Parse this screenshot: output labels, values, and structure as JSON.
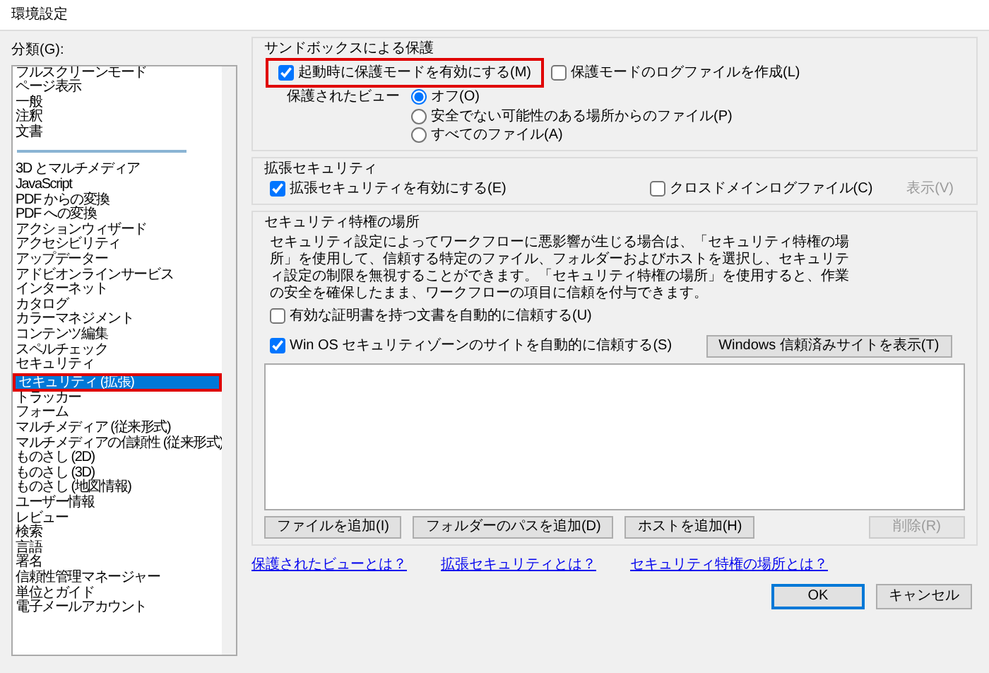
{
  "window": {
    "title": "環境設定"
  },
  "categories": {
    "label": "分類(G):",
    "groups": [
      [
        {
          "label": "フルスクリーンモード",
          "selected": false,
          "highlighted": false
        },
        {
          "label": "ページ表示",
          "selected": false,
          "highlighted": false
        },
        {
          "label": "一般",
          "selected": false,
          "highlighted": false
        },
        {
          "label": "注釈",
          "selected": false,
          "highlighted": false
        },
        {
          "label": "文書",
          "selected": false,
          "highlighted": false
        }
      ],
      [
        {
          "label": "3D とマルチメディア",
          "selected": false,
          "highlighted": false
        },
        {
          "label": "JavaScript",
          "selected": false,
          "highlighted": false
        },
        {
          "label": "PDF からの変換",
          "selected": false,
          "highlighted": false
        },
        {
          "label": "PDF への変換",
          "selected": false,
          "highlighted": false
        },
        {
          "label": "アクションウィザード",
          "selected": false,
          "highlighted": false
        },
        {
          "label": "アクセシビリティ",
          "selected": false,
          "highlighted": false
        },
        {
          "label": "アップデーター",
          "selected": false,
          "highlighted": false
        },
        {
          "label": "アドビオンラインサービス",
          "selected": false,
          "highlighted": false
        },
        {
          "label": "インターネット",
          "selected": false,
          "highlighted": false
        },
        {
          "label": "カタログ",
          "selected": false,
          "highlighted": false
        },
        {
          "label": "カラーマネジメント",
          "selected": false,
          "highlighted": false
        },
        {
          "label": "コンテンツ編集",
          "selected": false,
          "highlighted": false
        },
        {
          "label": "スペルチェック",
          "selected": false,
          "highlighted": false
        },
        {
          "label": "セキュリティ",
          "selected": false,
          "highlighted": false
        },
        {
          "label": "セキュリティ (拡張)",
          "selected": true,
          "highlighted": true
        },
        {
          "label": "トラッカー",
          "selected": false,
          "highlighted": false
        },
        {
          "label": "フォーム",
          "selected": false,
          "highlighted": false
        },
        {
          "label": "マルチメディア (従来形式)",
          "selected": false,
          "highlighted": false
        },
        {
          "label": "マルチメディアの信頼性 (従来形式)",
          "selected": false,
          "highlighted": false
        },
        {
          "label": "ものさし (2D)",
          "selected": false,
          "highlighted": false
        },
        {
          "label": "ものさし (3D)",
          "selected": false,
          "highlighted": false
        },
        {
          "label": "ものさし (地図情報)",
          "selected": false,
          "highlighted": false
        },
        {
          "label": "ユーザー情報",
          "selected": false,
          "highlighted": false
        },
        {
          "label": "レビュー",
          "selected": false,
          "highlighted": false
        },
        {
          "label": "検索",
          "selected": false,
          "highlighted": false
        },
        {
          "label": "言語",
          "selected": false,
          "highlighted": false
        },
        {
          "label": "署名",
          "selected": false,
          "highlighted": false
        },
        {
          "label": "信頼性管理マネージャー",
          "selected": false,
          "highlighted": false
        },
        {
          "label": "単位とガイド",
          "selected": false,
          "highlighted": false
        },
        {
          "label": "電子メールアカウント",
          "selected": false,
          "highlighted": false
        }
      ]
    ]
  },
  "sandbox": {
    "title": "サンドボックスによる保護",
    "options": [
      {
        "label": "起動時に保護モードを有効にする(M)",
        "checked": true,
        "highlighted": true
      },
      {
        "label": "保護モードのログファイルを作成(L)",
        "checked": false,
        "highlighted": false
      }
    ],
    "protected_view": {
      "label": "保護されたビュー",
      "choices": [
        {
          "label": "オフ(O)",
          "selected": true
        },
        {
          "label": "安全でない可能性のある場所からのファイル(P)",
          "selected": false
        },
        {
          "label": "すべてのファイル(A)",
          "selected": false
        }
      ]
    }
  },
  "enhanced": {
    "title": "拡張セキュリティ",
    "enable": {
      "label": "拡張セキュリティを有効にする(E)",
      "checked": true
    },
    "cross_domain": {
      "label": "クロスドメインログファイル(C)",
      "checked": false
    },
    "view_button": {
      "label": "表示(V)",
      "disabled": true
    }
  },
  "privileged": {
    "title": "セキュリティ特権の場所",
    "description": "セキュリティ設定によってワークフローに悪影響が生じる場合は、「セキュリティ特権の場所」を使用して、信頼する特定のファイル、フォルダーおよびホストを選択し、セキュリティ設定の制限を無視することができます。「セキュリティ特権の場所」を使用すると、作業の安全を確保したまま、ワークフローの項目に信頼を付与できます。",
    "options": [
      {
        "label": "有効な証明書を持つ文書を自動的に信頼する(U)",
        "checked": false
      },
      {
        "label": "Win OS セキュリティゾーンのサイトを自動的に信頼する(S)",
        "checked": true
      }
    ],
    "show_sites_button": "Windows 信頼済みサイトを表示(T)",
    "buttons": [
      {
        "label": "ファイルを追加(I)",
        "disabled": false
      },
      {
        "label": "フォルダーのパスを追加(D)",
        "disabled": false
      },
      {
        "label": "ホストを追加(H)",
        "disabled": false
      },
      {
        "label": "削除(R)",
        "disabled": true
      }
    ]
  },
  "links": [
    "保護されたビューとは？",
    "拡張セキュリティとは？",
    "セキュリティ特権の場所とは？"
  ],
  "dialog_buttons": [
    {
      "label": "OK",
      "default": true
    },
    {
      "label": "キャンセル",
      "default": false
    }
  ]
}
